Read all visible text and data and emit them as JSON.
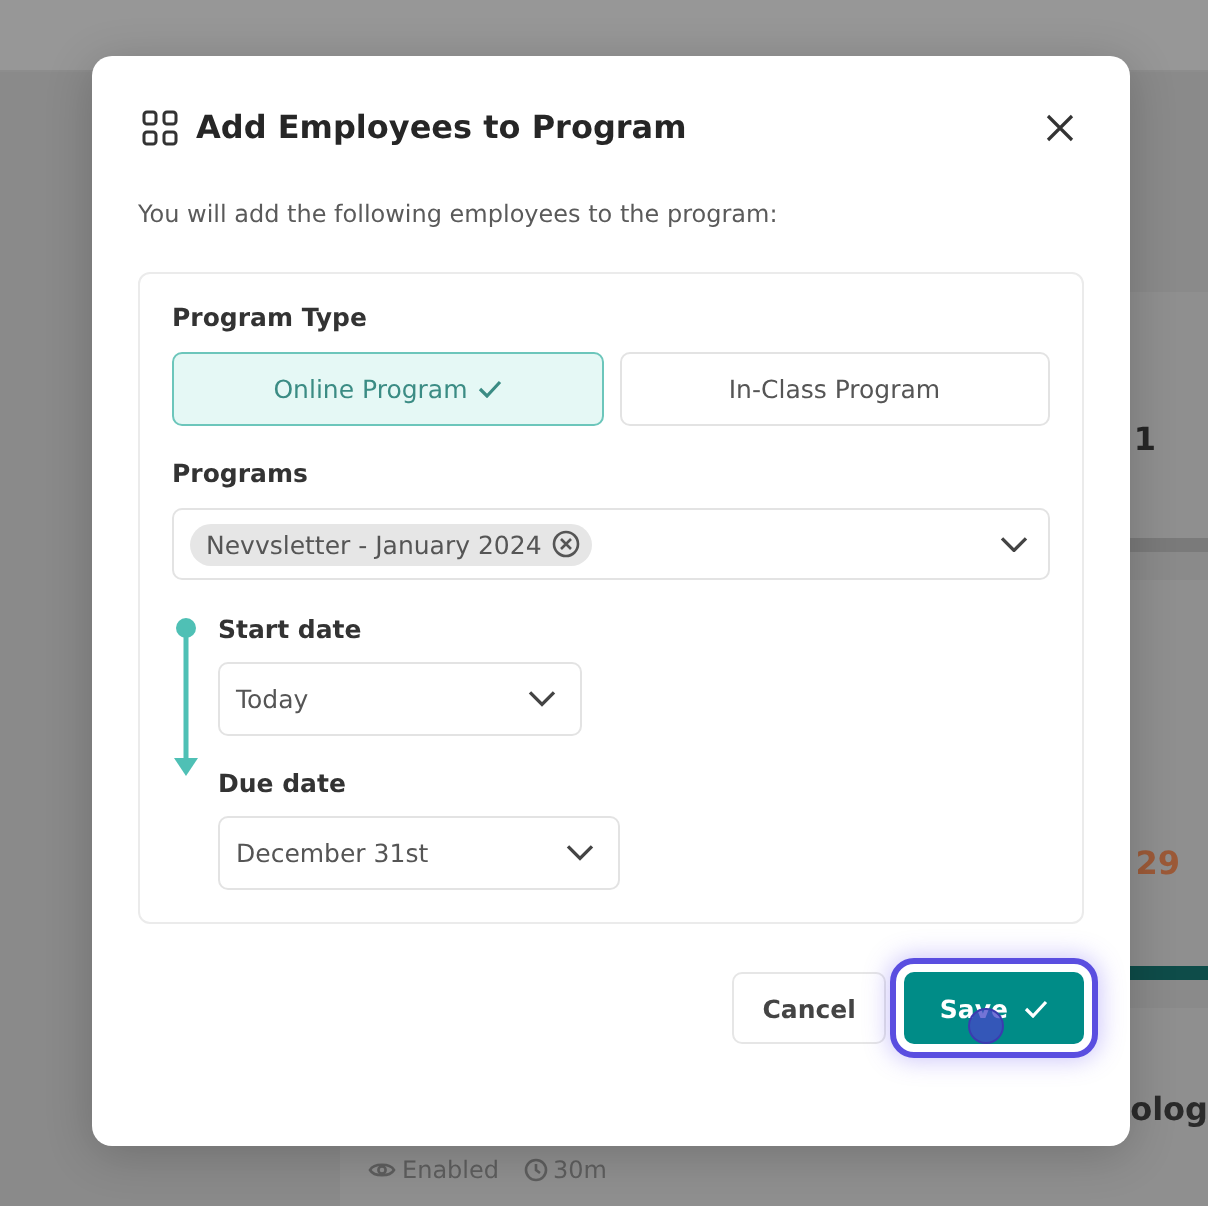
{
  "background": {
    "cards": [
      {
        "kind": "number",
        "text": "1"
      },
      {
        "kind": "due",
        "text": "29"
      },
      {
        "kind": "course",
        "text": "olog",
        "meta": [
          {
            "kind": "visibility",
            "text": "Enabled"
          },
          {
            "kind": "duration",
            "text": "30m"
          }
        ]
      }
    ]
  },
  "dialog": {
    "title": "Add Employees to Program",
    "intro": "You will add the following employees to the program:",
    "program_type": {
      "label": "Program Type",
      "options": [
        {
          "label": "Online Program",
          "selected": true
        },
        {
          "label": "In-Class Program",
          "selected": false
        }
      ]
    },
    "programs": {
      "label": "Programs",
      "chips": [
        "Nevvsletter - January 2024"
      ]
    },
    "start_date": {
      "label": "Start date",
      "value": "Today"
    },
    "due_date": {
      "label": "Due date",
      "value": "December 31st"
    },
    "buttons": [
      {
        "kind": "secondary",
        "label": "Cancel",
        "focused": false
      },
      {
        "kind": "primary",
        "label": "Save",
        "focused": true
      }
    ]
  }
}
